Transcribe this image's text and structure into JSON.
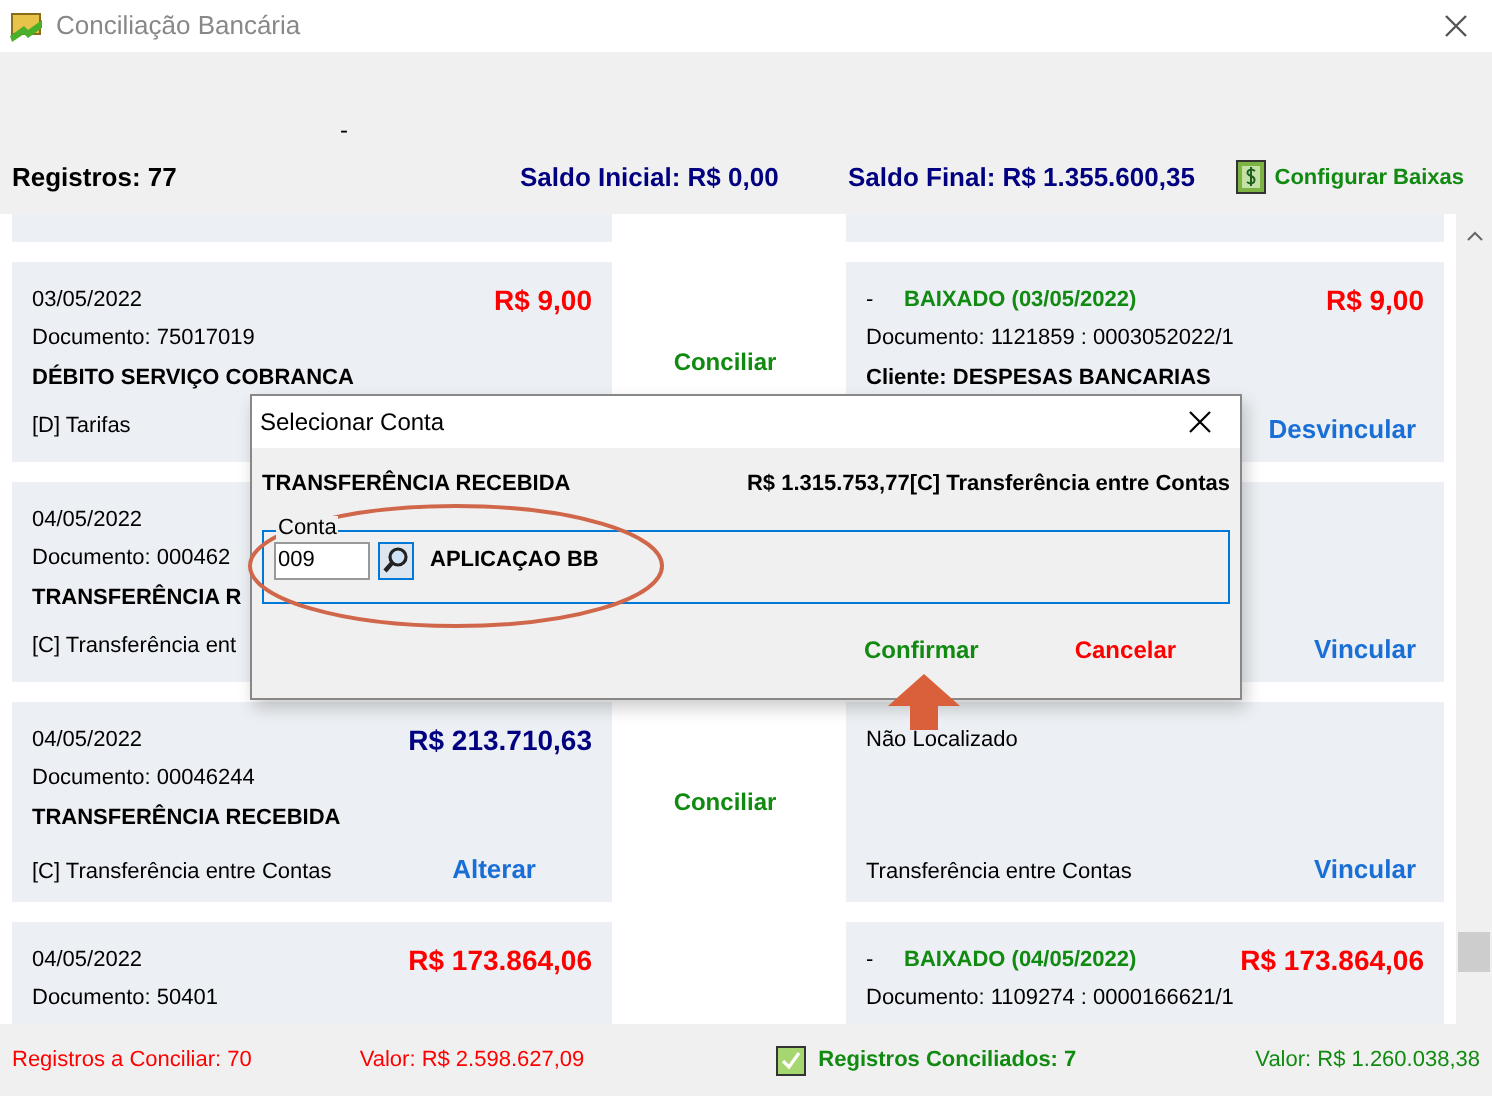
{
  "window": {
    "title": "Conciliação Bancária"
  },
  "header": {
    "dash": "-",
    "records": "Registros: 77",
    "opening_balance": "Saldo Inicial: R$ 0,00",
    "closing_balance": "Saldo Final: R$ 1.355.600,35",
    "configure": "Configurar Baixas"
  },
  "records": [
    {
      "left": {
        "date": "03/05/2022",
        "amount": "R$ 9,00",
        "kind": "debit",
        "document": "Documento: 75017019",
        "title": "DÉBITO SERVIÇO COBRANCA",
        "category": "[D] Tarifas"
      },
      "middle": "Conciliar",
      "right": {
        "kind": "matched",
        "dash": "-",
        "status": "BAIXADO (03/05/2022)",
        "amount": "R$ 9,00",
        "document": "Documento: 1121859 : 0003052022/1",
        "client": "Cliente: DESPESAS BANCARIAS",
        "action": "Desvincular"
      }
    },
    {
      "left": {
        "date": "04/05/2022",
        "document": "Documento: 000462",
        "title": "TRANSFERÊNCIA R",
        "category": "[C] Transferência ent"
      },
      "right": {
        "kind": "unmatched",
        "action": "Vincular"
      }
    },
    {
      "left": {
        "date": "04/05/2022",
        "amount": "R$ 213.710,63",
        "kind": "credit",
        "document": "Documento: 00046244",
        "title": "TRANSFERÊNCIA RECEBIDA",
        "category": "[C] Transferência entre Contas",
        "action": "Alterar"
      },
      "middle": "Conciliar",
      "right": {
        "kind": "unmatched",
        "note": "Não Localizado",
        "category": "Transferência entre Contas",
        "action": "Vincular"
      }
    },
    {
      "left": {
        "date": "04/05/2022",
        "amount": "R$ 173.864,06",
        "kind": "debit",
        "document": "Documento: 50401"
      },
      "right": {
        "kind": "matched",
        "dash": "-",
        "status": "BAIXADO (04/05/2022)",
        "amount": "R$ 173.864,06",
        "document": "Documento: 1109274 : 0000166621/1"
      }
    }
  ],
  "status_bar": {
    "pending": "Registros a Conciliar: 70",
    "pending_value": "Valor: R$ 2.598.627,09",
    "reconciled": "Registros Conciliados: 7",
    "reconciled_value": "Valor: R$ 1.260.038,38"
  },
  "dialog": {
    "title": "Selecionar Conta",
    "description": "TRANSFERÊNCIA RECEBIDA",
    "amount": "R$ 1.315.753,77[C] Transferência entre Contas",
    "legend": "Conta",
    "account_code": "009",
    "account_name": "APLICAÇAO BB",
    "buttons": [
      "Confirmar",
      "Cancelar"
    ]
  }
}
